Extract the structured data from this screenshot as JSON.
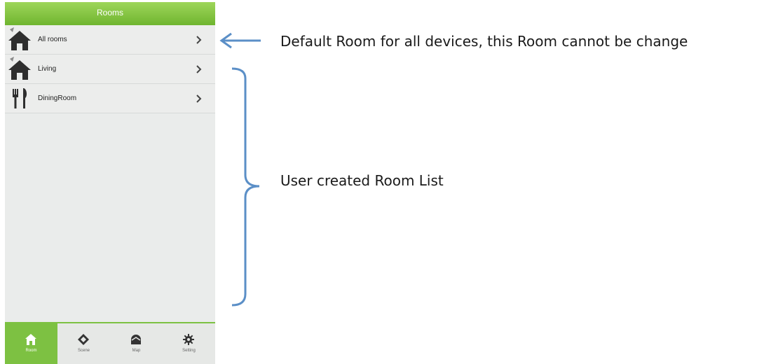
{
  "app": {
    "title": "Rooms"
  },
  "rooms": [
    {
      "label": "All rooms",
      "icon": "house-icon"
    },
    {
      "label": "Living",
      "icon": "house-icon"
    },
    {
      "label": "DiningRoom",
      "icon": "fork-knife-icon"
    }
  ],
  "tabs": [
    {
      "label": "Room",
      "icon": "home-icon",
      "active": true
    },
    {
      "label": "Scene",
      "icon": "scene-icon",
      "active": false
    },
    {
      "label": "Map",
      "icon": "map-icon",
      "active": false
    },
    {
      "label": "Setting",
      "icon": "gear-icon",
      "active": false
    }
  ],
  "annotations": {
    "default_room_note": "Default Room for all devices, this Room cannot be change",
    "user_room_note": "User created Room List"
  },
  "colors": {
    "brand_green": "#7dc142",
    "annotation_blue": "#5b8fc7"
  }
}
